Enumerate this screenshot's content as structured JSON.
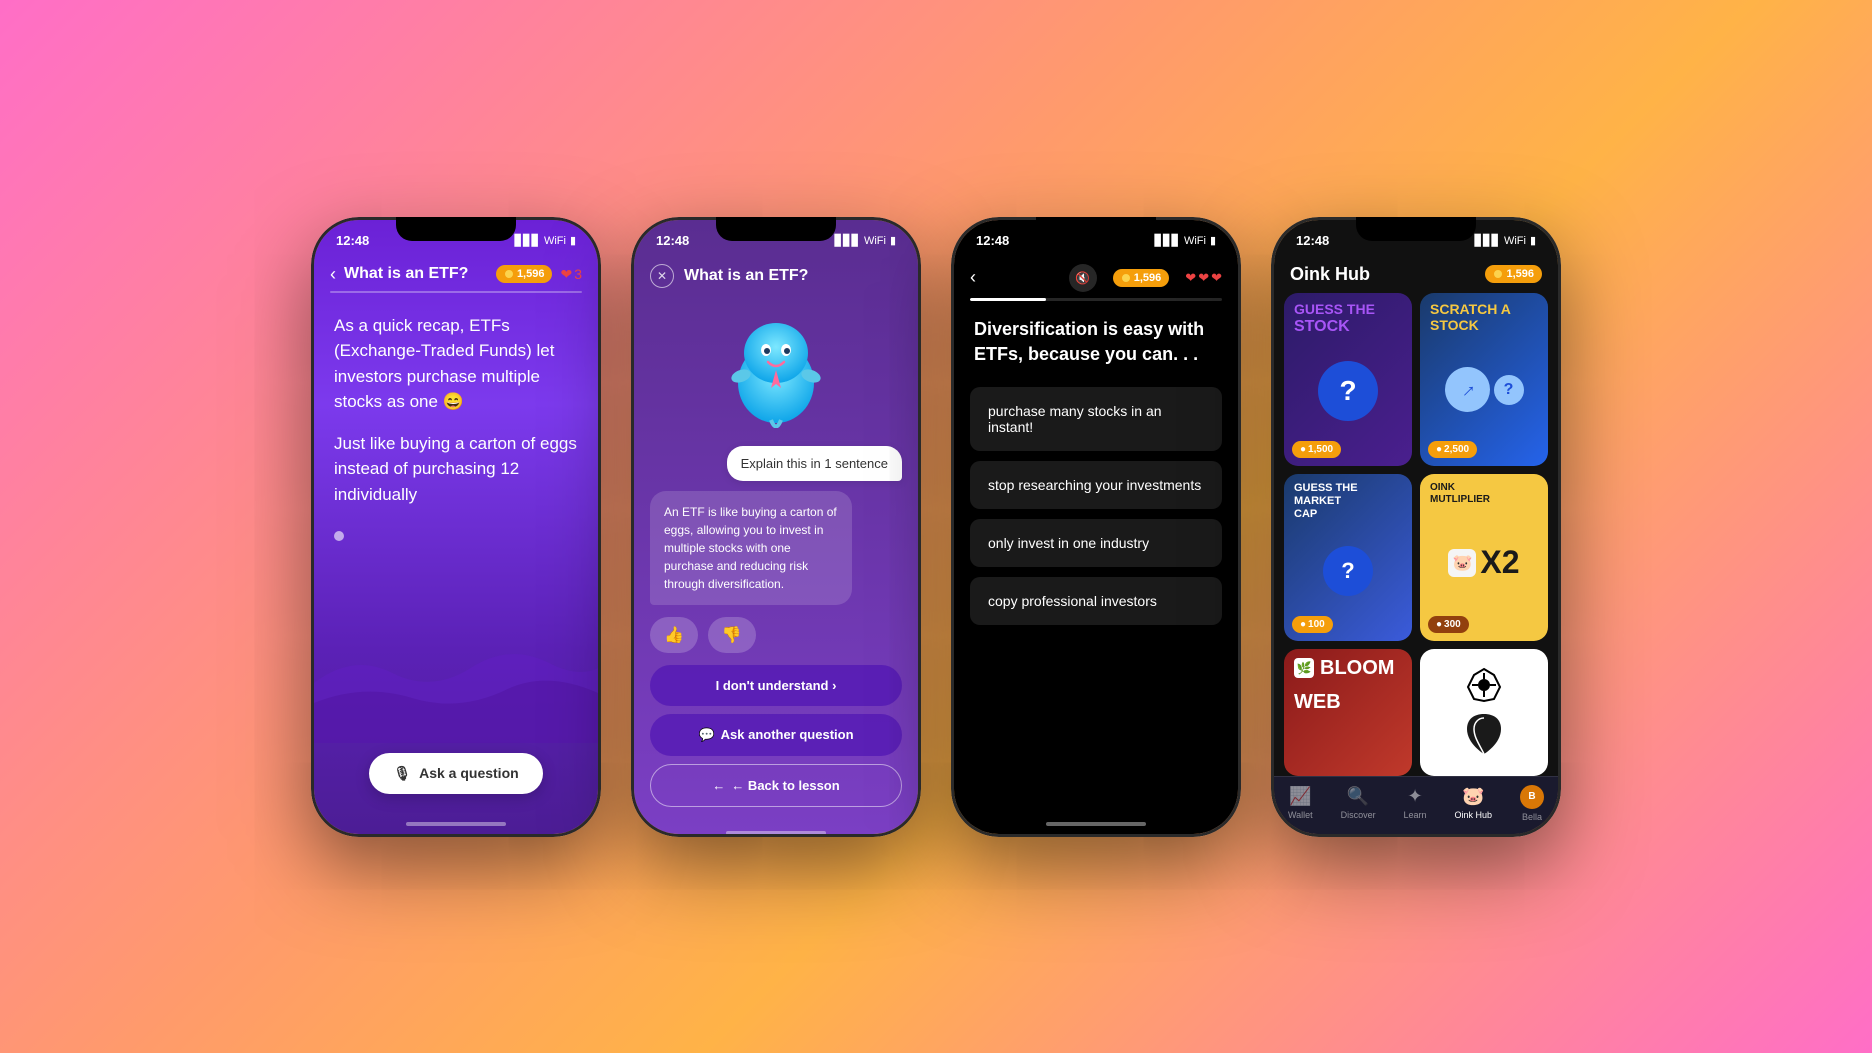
{
  "background": {
    "gradient": "pink-orange"
  },
  "phones": [
    {
      "id": "phone-1",
      "theme": "purple",
      "status_bar": {
        "time": "12:48",
        "signal": "▊▊▊",
        "wifi": "WiFi",
        "battery": "◻"
      },
      "header": {
        "back_label": "‹",
        "title": "What is an ETF?",
        "coins": "1,596",
        "hearts": "3"
      },
      "content": {
        "paragraph1": "As a quick recap, ETFs (Exchange-Traded Funds) let investors purchase multiple stocks as one 😄",
        "paragraph2": "Just like buying a carton of eggs instead of purchasing 12 individually"
      },
      "footer": {
        "ask_btn_label": "Ask a question",
        "ask_icon": "🎙"
      }
    },
    {
      "id": "phone-2",
      "theme": "purple-gradient",
      "status_bar": {
        "time": "12:48"
      },
      "header": {
        "close_label": "✕",
        "title": "What is an ETF?"
      },
      "chat": {
        "user_bubble": "Explain this in 1 sentence",
        "ai_bubble": "An ETF is like buying a carton of eggs, allowing you to invest in multiple stocks with one purchase and reducing risk through diversification.",
        "thumbs_up": "👍",
        "thumbs_down": "👎"
      },
      "actions": {
        "dont_understand": "I don't understand ›",
        "ask_another": "Ask another question",
        "back_to_lesson": "← Back to lesson"
      }
    },
    {
      "id": "phone-3",
      "theme": "dark",
      "status_bar": {
        "time": "12:48"
      },
      "header": {
        "back_label": "‹",
        "mute_icon": "🔇",
        "coins": "1,596",
        "hearts": "❤❤❤"
      },
      "question": "Diversification is easy with ETFs, because you can. . .",
      "options": [
        "purchase many stocks in an instant!",
        "stop researching your investments",
        "only invest in one industry",
        "copy professional investors"
      ]
    },
    {
      "id": "phone-4",
      "theme": "dark-navy",
      "status_bar": {
        "time": "12:48"
      },
      "header": {
        "title": "Oink Hub",
        "coins": "1,596"
      },
      "cards": [
        {
          "id": "guess-stock",
          "title": "GUESS THE STOCK",
          "color": "purple",
          "icon": "?",
          "coin_cost": "1,500"
        },
        {
          "id": "scratch-stock",
          "title": "SCRATCH A STOCK",
          "color": "blue",
          "icon": "→",
          "coin_cost": "2,500"
        },
        {
          "id": "market-cap",
          "title": "GUESS THE MARKET CAP",
          "color": "blue",
          "icon": "?",
          "coin_cost": "100"
        },
        {
          "id": "multiplier",
          "title": "OINK MUTLIPLIER",
          "color": "yellow",
          "icon": "X2",
          "coin_cost": "300"
        },
        {
          "id": "bloom-web",
          "title": "BLOOM WEB",
          "color": "red"
        },
        {
          "id": "logo-card",
          "color": "white"
        }
      ],
      "nav": {
        "items": [
          {
            "label": "Wallet",
            "icon": "📈",
            "active": false
          },
          {
            "label": "Discover",
            "icon": "🔍",
            "active": false
          },
          {
            "label": "Learn",
            "icon": "⭐",
            "active": false
          },
          {
            "label": "Oink Hub",
            "icon": "🐷",
            "active": true
          },
          {
            "label": "Bella",
            "icon": "👤",
            "active": false
          }
        ]
      }
    }
  ]
}
